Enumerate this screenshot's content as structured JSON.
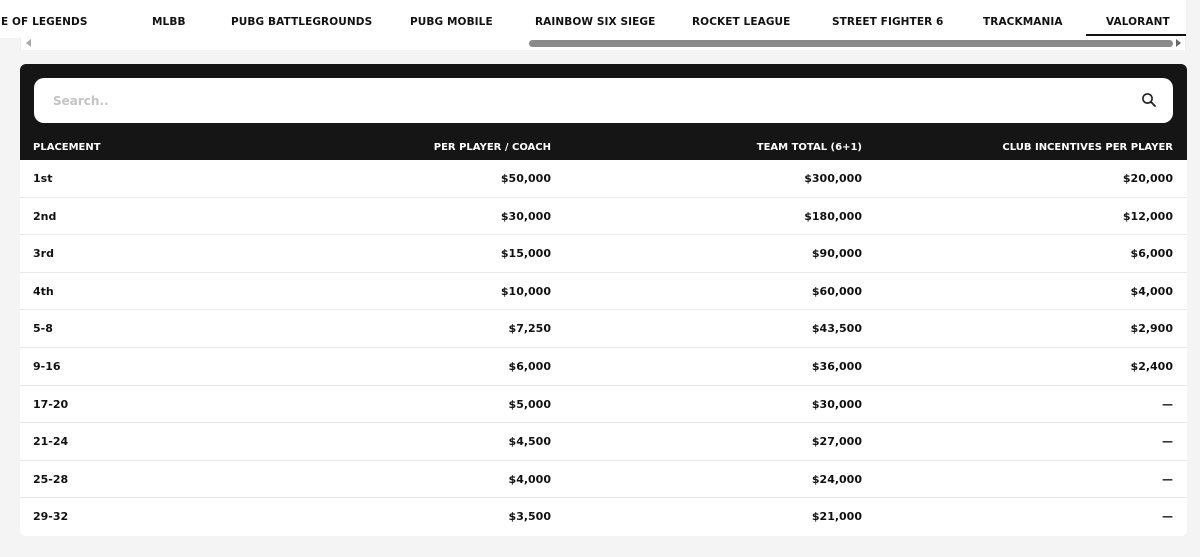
{
  "tabs": [
    {
      "label": "JE OF LEGENDS"
    },
    {
      "label": "MLBB"
    },
    {
      "label": "PUBG BATTLEGROUNDS"
    },
    {
      "label": "PUBG MOBILE"
    },
    {
      "label": "RAINBOW SIX SIEGE"
    },
    {
      "label": "ROCKET LEAGUE"
    },
    {
      "label": "STREET FIGHTER 6"
    },
    {
      "label": "TRACKMANIA"
    },
    {
      "label": "VALORANT"
    }
  ],
  "active_tab": "VALORANT",
  "search": {
    "placeholder": "Search..",
    "value": ""
  },
  "table": {
    "headers": [
      "PLACEMENT",
      "PER PLAYER / COACH",
      "TEAM TOTAL (6+1)",
      "CLUB INCENTIVES PER PLAYER"
    ],
    "rows": [
      [
        "1st",
        "$50,000",
        "$300,000",
        "$20,000"
      ],
      [
        "2nd",
        "$30,000",
        "$180,000",
        "$12,000"
      ],
      [
        "3rd",
        "$15,000",
        "$90,000",
        "$6,000"
      ],
      [
        "4th",
        "$10,000",
        "$60,000",
        "$4,000"
      ],
      [
        "5-8",
        "$7,250",
        "$43,500",
        "$2,900"
      ],
      [
        "9-16",
        "$6,000",
        "$36,000",
        "$2,400"
      ],
      [
        "17-20",
        "$5,000",
        "$30,000",
        "—"
      ],
      [
        "21-24",
        "$4,500",
        "$27,000",
        "—"
      ],
      [
        "25-28",
        "$4,000",
        "$24,000",
        "—"
      ],
      [
        "29-32",
        "$3,500",
        "$21,000",
        "—"
      ]
    ]
  },
  "icons": {
    "search": "search-icon"
  },
  "colors": {
    "header_bg": "#151515",
    "accent": "#111111",
    "page_bg": "#f4f4f4"
  }
}
